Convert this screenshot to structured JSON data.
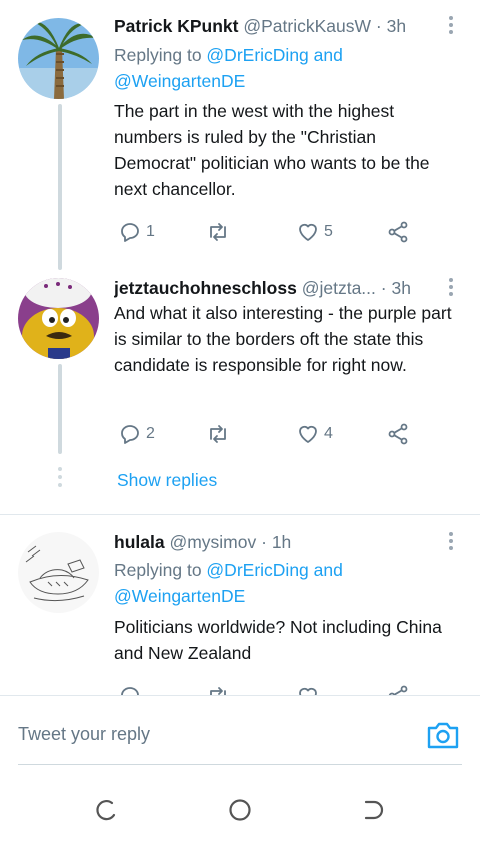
{
  "tweets": [
    {
      "name": "Patrick KPunkt",
      "handle": "@PatrickKausW",
      "time": "· 3h",
      "replying_prefix": "Replying to ",
      "replying_user1": "@DrEricDing",
      "replying_and": " and",
      "replying_user2": "@WeingartenDE",
      "text": "The part in the west with the highest numbers is ruled by the \"Christian Democrat\" politician who wants to be the next chancellor.",
      "replies": "1",
      "retweets": "",
      "likes": "5"
    },
    {
      "name": "jetztauchohneschloss",
      "handle": "@jetztа...",
      "time": "· 3h",
      "text": "And what it also interesting - the purple part is similar to the borders oft the state this candidate is responsible for right now.",
      "replies": "2",
      "retweets": "",
      "likes": "4"
    },
    {
      "name": "hulala",
      "handle": "@mysimov",
      "time": "· 1h",
      "replying_prefix": "Replying to ",
      "replying_user1": "@DrEricDing",
      "replying_and": " and",
      "replying_user2": "@WeingartenDE",
      "text": "Politicians worldwide? Not including China and New Zealand"
    }
  ],
  "show_replies": "Show replies",
  "reply_placeholder": "Tweet your reply",
  "colors": {
    "accent": "#1da1f2",
    "muted": "#657786",
    "text": "#14171a"
  }
}
